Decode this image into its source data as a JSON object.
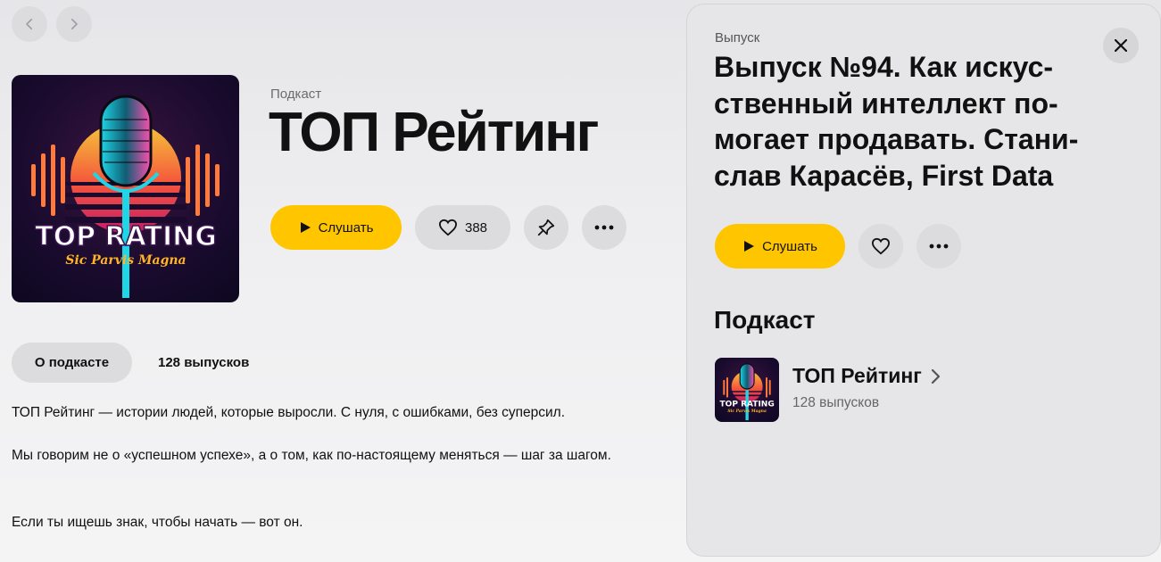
{
  "nav": {
    "back_icon": "chevron-left-icon",
    "forward_icon": "chevron-right-icon"
  },
  "cover": {
    "line1": "TOP RATING",
    "line2": "Sic Parvis Magna"
  },
  "podcast": {
    "kicker": "Подкаст",
    "title": "ТОП Рейтинг",
    "play_label": "Слушать",
    "likes": "388"
  },
  "tabs": {
    "about": "О подкасте",
    "episodes": "128 выпусков"
  },
  "description": {
    "p1": "ТОП Рейтинг — истории людей, которые выросли. С нуля, с ошибками, без суперсил.",
    "p2": "Мы говорим не о «успешном успехе», а о том, как по-настоящему меняться — шаг за шагом.",
    "p3": "Если ты ищешь знак, чтобы начать — вот он."
  },
  "panel": {
    "kicker": "Выпуск",
    "title": "Выпуск №94. Как искус-ственный интеллект по-могает продавать. Стани-слав Карасёв, First Data",
    "play_label": "Слушать",
    "section_title": "Подкаст",
    "podcast_name": "ТОП Рейтинг",
    "podcast_count": "128 выпусков"
  },
  "colors": {
    "accent": "#ffc600",
    "button_gray": "#dcdcdf"
  }
}
